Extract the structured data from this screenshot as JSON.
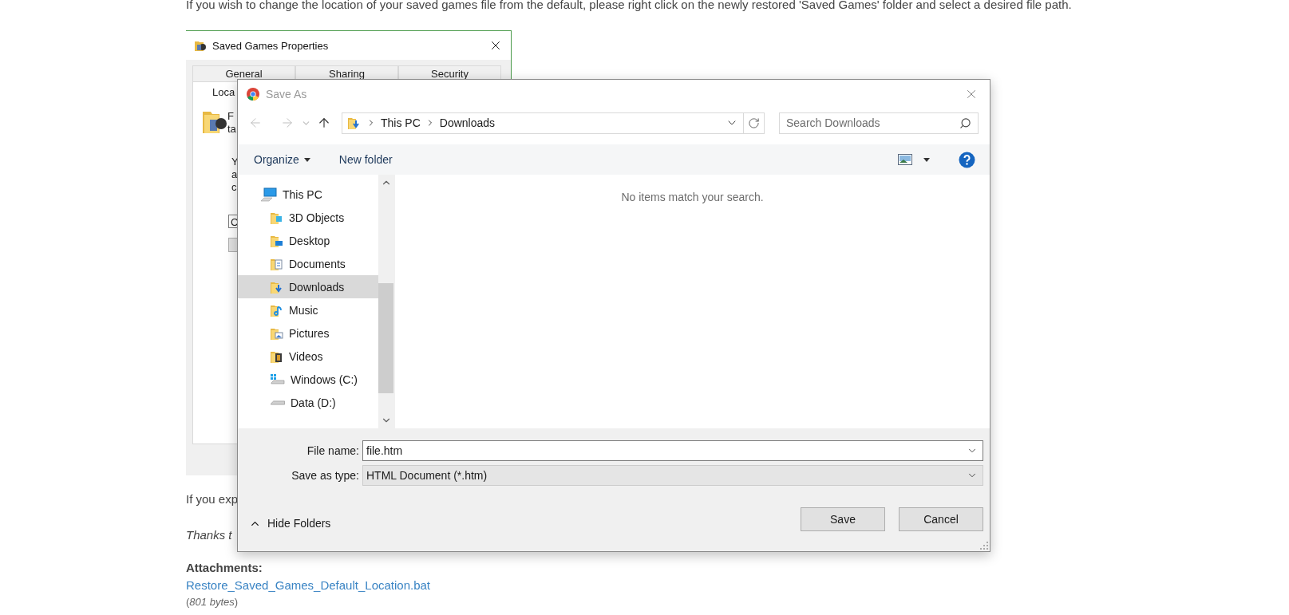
{
  "intro_text": "If you wish to change the location of your saved games file from the default, please right click on the newly restored 'Saved Games' folder and select a desired file path.",
  "properties_window": {
    "title": "Saved Games Properties",
    "tabs": [
      {
        "label": "General",
        "selected": false
      },
      {
        "label": "Sharing",
        "selected": false
      },
      {
        "label": "Security",
        "selected": false
      },
      {
        "label": "Loca",
        "selected": true
      }
    ],
    "info_lines": [
      "F",
      "ta"
    ],
    "body_lines": [
      "Y",
      "a",
      "c"
    ],
    "field_value": "C"
  },
  "save_dialog": {
    "title": "Save As",
    "breadcrumb": [
      "This PC",
      "Downloads"
    ],
    "search": {
      "placeholder": "Search Downloads"
    },
    "toolbar": {
      "organize": "Organize",
      "new_folder": "New folder"
    },
    "nav_tree": [
      {
        "label": "This PC",
        "kind": "pc",
        "selected": false,
        "children": [
          {
            "label": "3D Objects",
            "kind": "objects",
            "selected": false
          },
          {
            "label": "Desktop",
            "kind": "desktop",
            "selected": false
          },
          {
            "label": "Documents",
            "kind": "documents",
            "selected": false
          },
          {
            "label": "Downloads",
            "kind": "downloads",
            "selected": true
          },
          {
            "label": "Music",
            "kind": "music",
            "selected": false
          },
          {
            "label": "Pictures",
            "kind": "pictures",
            "selected": false
          },
          {
            "label": "Videos",
            "kind": "videos",
            "selected": false
          },
          {
            "label": "Windows (C:)",
            "kind": "system-drive",
            "selected": false
          },
          {
            "label": "Data (D:)",
            "kind": "drive",
            "selected": false
          }
        ]
      }
    ],
    "empty_message": "No items match your search.",
    "file_name": {
      "label": "File name:",
      "value": "file.htm"
    },
    "save_type": {
      "label": "Save as type:",
      "value": "HTML Document (*.htm)"
    },
    "hide_folders": "Hide Folders",
    "buttons": [
      "Save",
      "Cancel"
    ]
  },
  "after_text": "If you exp",
  "thanks_text": "Thanks t",
  "attachments": {
    "heading": "Attachments:",
    "link": "Restore_Saved_Games_Default_Location.bat",
    "size": "(*801 bytes*)"
  }
}
